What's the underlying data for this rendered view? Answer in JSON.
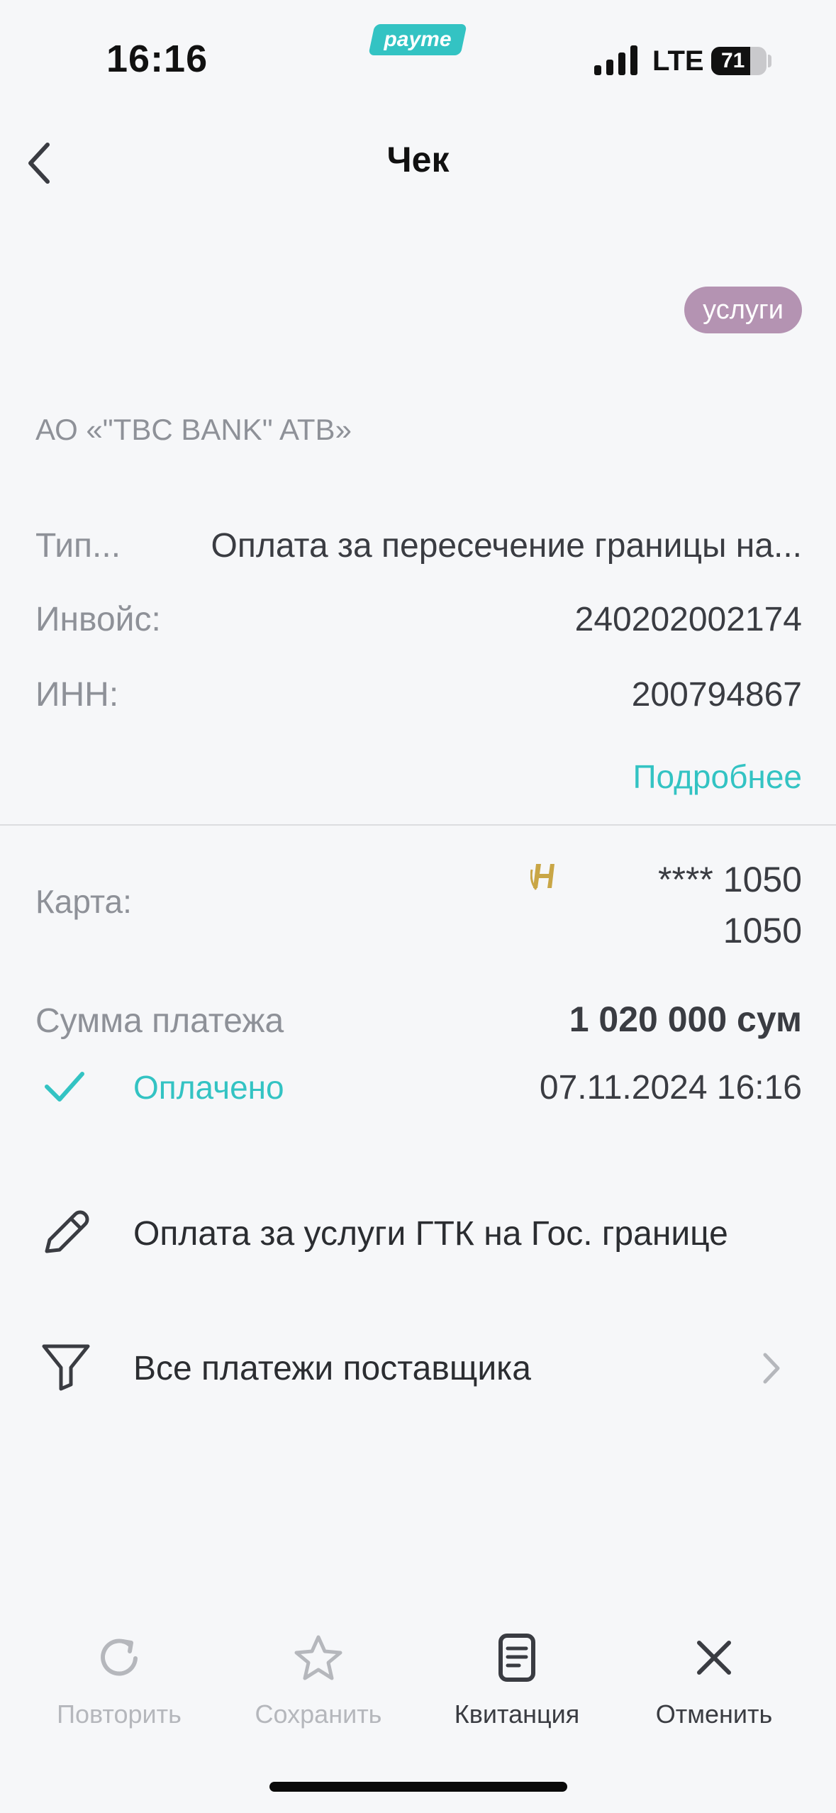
{
  "status_bar": {
    "time": "16:16",
    "brand": "payme",
    "network": "LTE",
    "battery": "71"
  },
  "header": {
    "title": "Чек",
    "back_icon": "chevron-left-icon"
  },
  "category_tag": "услуги",
  "provider": "АО «\"TBC BANK\" ATB»",
  "details": [
    {
      "label": "Тип...",
      "value": "Оплата за пересечение границы на..."
    },
    {
      "label": "Инвойс:",
      "value": "240202002174"
    },
    {
      "label": "ИНН:",
      "value": "200794867"
    }
  ],
  "more_link": "Подробнее",
  "card": {
    "label": "Карта:",
    "number": "**** 1050",
    "number_line2": "1050",
    "logo_letter": "H"
  },
  "payment": {
    "amount_label": "Сумма платежа",
    "amount_value": "1 020 000 сум",
    "status": "Оплачено",
    "datetime": "07.11.2024 16:16"
  },
  "actions": [
    {
      "label": "Оплата за услуги ГТК на Гос. границе",
      "icon": "pencil-icon"
    },
    {
      "label": "Все платежи поставщика",
      "icon": "filter-icon"
    }
  ],
  "tabbar": [
    {
      "label": "Повторить",
      "icon": "refresh-icon",
      "enabled": false
    },
    {
      "label": "Сохранить",
      "icon": "star-icon",
      "enabled": false
    },
    {
      "label": "Квитанция",
      "icon": "receipt-icon",
      "enabled": true
    },
    {
      "label": "Отменить",
      "icon": "close-icon",
      "enabled": true
    }
  ],
  "colors": {
    "accent": "#33c3c3",
    "tag": "#b493b2",
    "background": "#f6f7f9"
  }
}
